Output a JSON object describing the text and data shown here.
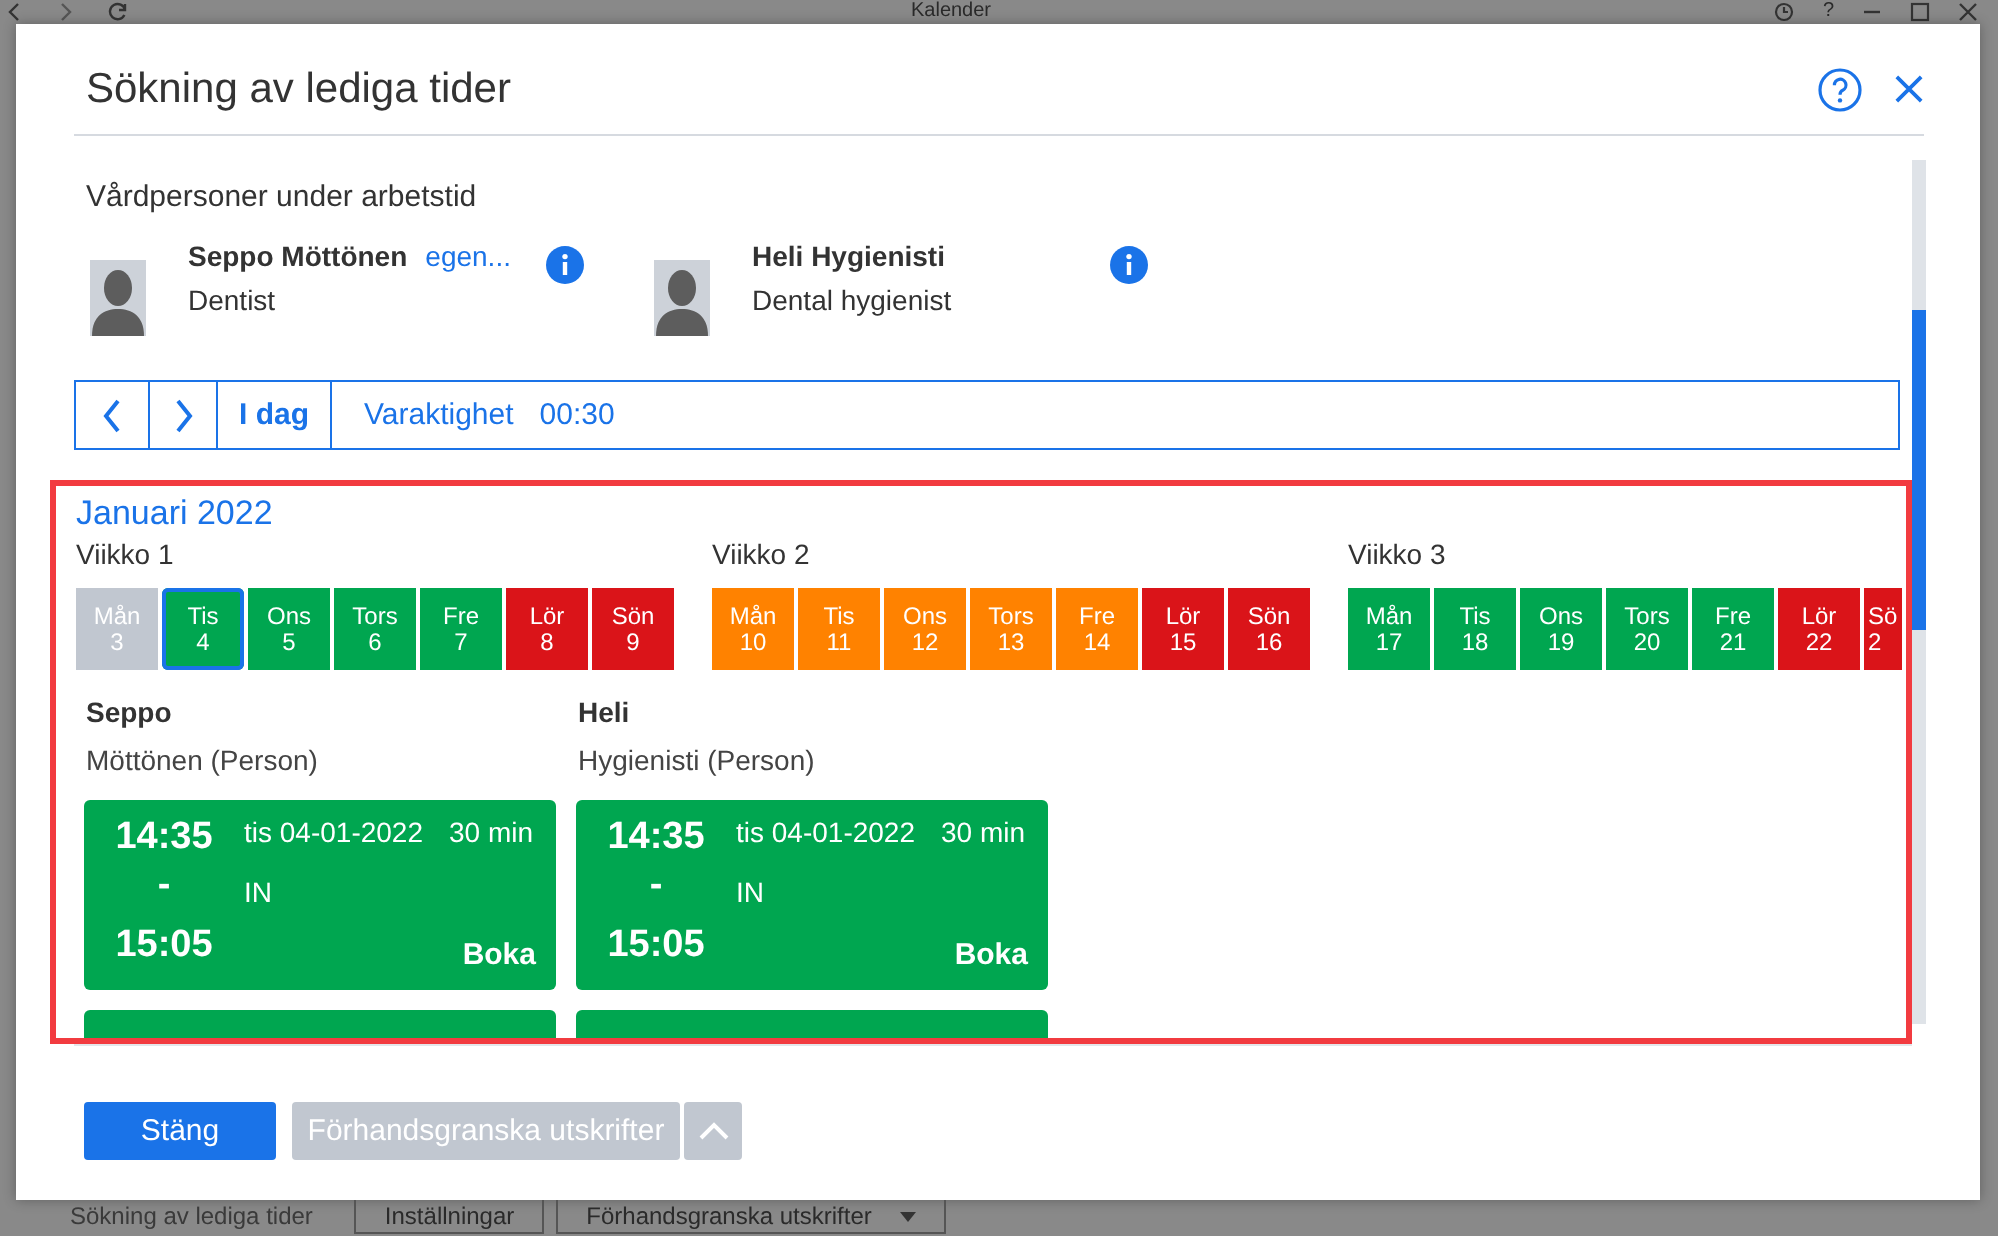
{
  "background": {
    "title": "Kalender",
    "help_glyph": "?",
    "tabs": [
      {
        "label": "Sökning av lediga tider",
        "selected": true,
        "dropdown": false
      },
      {
        "label": "Inställningar",
        "selected": false,
        "dropdown": false
      },
      {
        "label": "Förhandsgranska utskrifter",
        "selected": false,
        "dropdown": true
      }
    ]
  },
  "dialog": {
    "title": "Sökning av lediga tider"
  },
  "staff": {
    "heading": "Vårdpersoner under arbetstid",
    "people": [
      {
        "name": "Seppo Möttönen",
        "link": "egen...",
        "role": "Dentist"
      },
      {
        "name": "Heli Hygienisti",
        "role": "Dental hygienist"
      }
    ]
  },
  "toolbar": {
    "today": "I dag",
    "duration_label": "Varaktighet",
    "duration": "00:30"
  },
  "calendar": {
    "month": "Januari 2022",
    "weeks": [
      {
        "label": "Viikko 1",
        "days": [
          {
            "day": "Mån",
            "date": "3",
            "color": "#c1c7d0",
            "selected": false,
            "cut": false
          },
          {
            "day": "Tis",
            "date": "4",
            "color": "#00a650",
            "selected": true,
            "cut": false
          },
          {
            "day": "Ons",
            "date": "5",
            "color": "#00a650",
            "selected": false,
            "cut": false
          },
          {
            "day": "Tors",
            "date": "6",
            "color": "#00a650",
            "selected": false,
            "cut": false
          },
          {
            "day": "Fre",
            "date": "7",
            "color": "#00a650",
            "selected": false,
            "cut": false
          },
          {
            "day": "Lör",
            "date": "8",
            "color": "#da1419",
            "selected": false,
            "cut": false
          },
          {
            "day": "Sön",
            "date": "9",
            "color": "#da1419",
            "selected": false,
            "cut": false
          }
        ]
      },
      {
        "label": "Viikko 2",
        "days": [
          {
            "day": "Mån",
            "date": "10",
            "color": "#ff8200",
            "selected": false,
            "cut": false
          },
          {
            "day": "Tis",
            "date": "11",
            "color": "#ff8200",
            "selected": false,
            "cut": false
          },
          {
            "day": "Ons",
            "date": "12",
            "color": "#ff8200",
            "selected": false,
            "cut": false
          },
          {
            "day": "Tors",
            "date": "13",
            "color": "#ff8200",
            "selected": false,
            "cut": false
          },
          {
            "day": "Fre",
            "date": "14",
            "color": "#ff8200",
            "selected": false,
            "cut": false
          },
          {
            "day": "Lör",
            "date": "15",
            "color": "#da1419",
            "selected": false,
            "cut": false
          },
          {
            "day": "Sön",
            "date": "16",
            "color": "#da1419",
            "selected": false,
            "cut": false
          }
        ]
      },
      {
        "label": "Viikko 3",
        "days": [
          {
            "day": "Mån",
            "date": "17",
            "color": "#00a650",
            "selected": false,
            "cut": false
          },
          {
            "day": "Tis",
            "date": "18",
            "color": "#00a650",
            "selected": false,
            "cut": false
          },
          {
            "day": "Ons",
            "date": "19",
            "color": "#00a650",
            "selected": false,
            "cut": false
          },
          {
            "day": "Tors",
            "date": "20",
            "color": "#00a650",
            "selected": false,
            "cut": false
          },
          {
            "day": "Fre",
            "date": "21",
            "color": "#00a650",
            "selected": false,
            "cut": false
          },
          {
            "day": "Lör",
            "date": "22",
            "color": "#da1419",
            "selected": false,
            "cut": false
          },
          {
            "day": "Sö",
            "date": "2",
            "color": "#da1419",
            "selected": false,
            "cut": true
          }
        ]
      }
    ]
  },
  "columns": [
    {
      "first_name": "Seppo",
      "detail": "Möttönen (Person)",
      "slots": [
        {
          "start": "14:35",
          "separator": "-",
          "end": "15:05",
          "date": "tis 04-01-2022",
          "length": "30 min",
          "code": "IN",
          "action": "Boka"
        }
      ],
      "more_below": true
    },
    {
      "first_name": "Heli",
      "detail": "Hygienisti (Person)",
      "slots": [
        {
          "start": "14:35",
          "separator": "-",
          "end": "15:05",
          "date": "tis 04-01-2022",
          "length": "30 min",
          "code": "IN",
          "action": "Boka"
        }
      ],
      "more_below": true
    }
  ],
  "footer": {
    "buttons": [
      {
        "kind": "primary",
        "label": "Stäng",
        "disabled": false
      },
      {
        "kind": "secondary",
        "label": "Förhandsgranska utskrifter",
        "disabled": true
      },
      {
        "kind": "caret",
        "disabled": true
      }
    ]
  }
}
